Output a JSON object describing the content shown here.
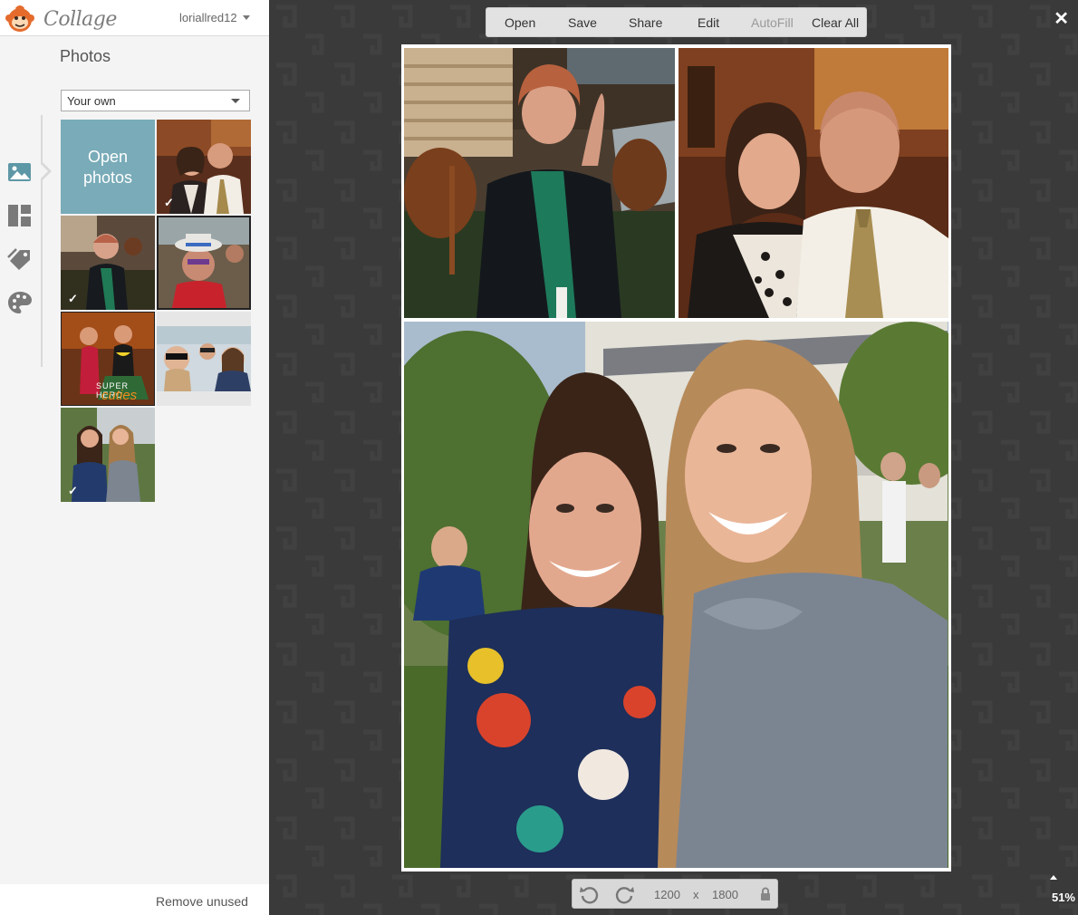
{
  "app": {
    "logo_text": "Collage",
    "username": "loriallred12"
  },
  "sidebar": {
    "title": "Photos",
    "source_select": "Your own",
    "open_photos_line1": "Open",
    "open_photos_line2": "photos",
    "nav": [
      "photos-icon",
      "layout-icon",
      "stickers-icon",
      "palette-icon"
    ],
    "thumbnails": [
      {
        "subject": "couple selfie",
        "used": true
      },
      {
        "subject": "woman waving",
        "used": true
      },
      {
        "subject": "woman with hat",
        "used": false
      },
      {
        "subject": "superhero girls",
        "used": false,
        "caption_line1": "SUPER HERO",
        "caption_line2": "cuties"
      },
      {
        "subject": "group selfie",
        "used": false
      },
      {
        "subject": "two girls",
        "used": true
      }
    ],
    "remove_unused": "Remove unused"
  },
  "toolbar": {
    "open": "Open",
    "save": "Save",
    "share": "Share",
    "edit": "Edit",
    "autofill": "AutoFill",
    "clear_all": "Clear All"
  },
  "canvas": {
    "width": "1200",
    "height": "1800",
    "times": "x"
  },
  "zoom": "51%",
  "colors": {
    "accent": "#79abb8",
    "workspace": "#3a3a3a",
    "sidebar": "#f4f4f4"
  }
}
